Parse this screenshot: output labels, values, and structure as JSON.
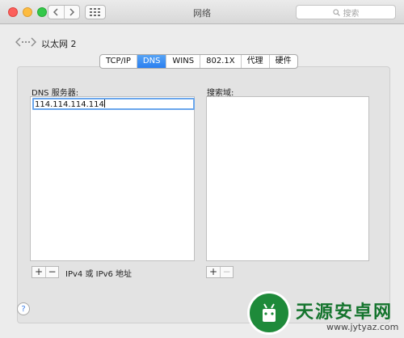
{
  "window": {
    "title": "网络"
  },
  "search": {
    "placeholder": "搜索",
    "icon": "search-icon"
  },
  "toolbar": {
    "back_icon": "chevron-left-icon",
    "forward_icon": "chevron-right-icon",
    "grid_icon": "grid-icon"
  },
  "interface": {
    "name": "以太网 2",
    "icon": "network-ethernet-icon"
  },
  "tabs": [
    {
      "label": "TCP/IP"
    },
    {
      "label": "DNS",
      "active": true
    },
    {
      "label": "WINS"
    },
    {
      "label": "802.1X"
    },
    {
      "label": "代理"
    },
    {
      "label": "硬件"
    }
  ],
  "dns": {
    "label": "DNS 服务器:",
    "servers": [
      "114.114.114.114"
    ],
    "add_label": "+",
    "remove_label": "−",
    "hint": "IPv4 或 IPv6 地址"
  },
  "search_domains": {
    "label": "搜索域:",
    "add_label": "+",
    "remove_label": "−"
  },
  "help": {
    "label": "?"
  },
  "watermark": {
    "text": "天源安卓网",
    "url": "www.jytyaz.com"
  },
  "colors": {
    "accent": "#2a7ff0",
    "focus_ring": "#6aa6ec",
    "watermark_green": "#1e8a3a"
  }
}
